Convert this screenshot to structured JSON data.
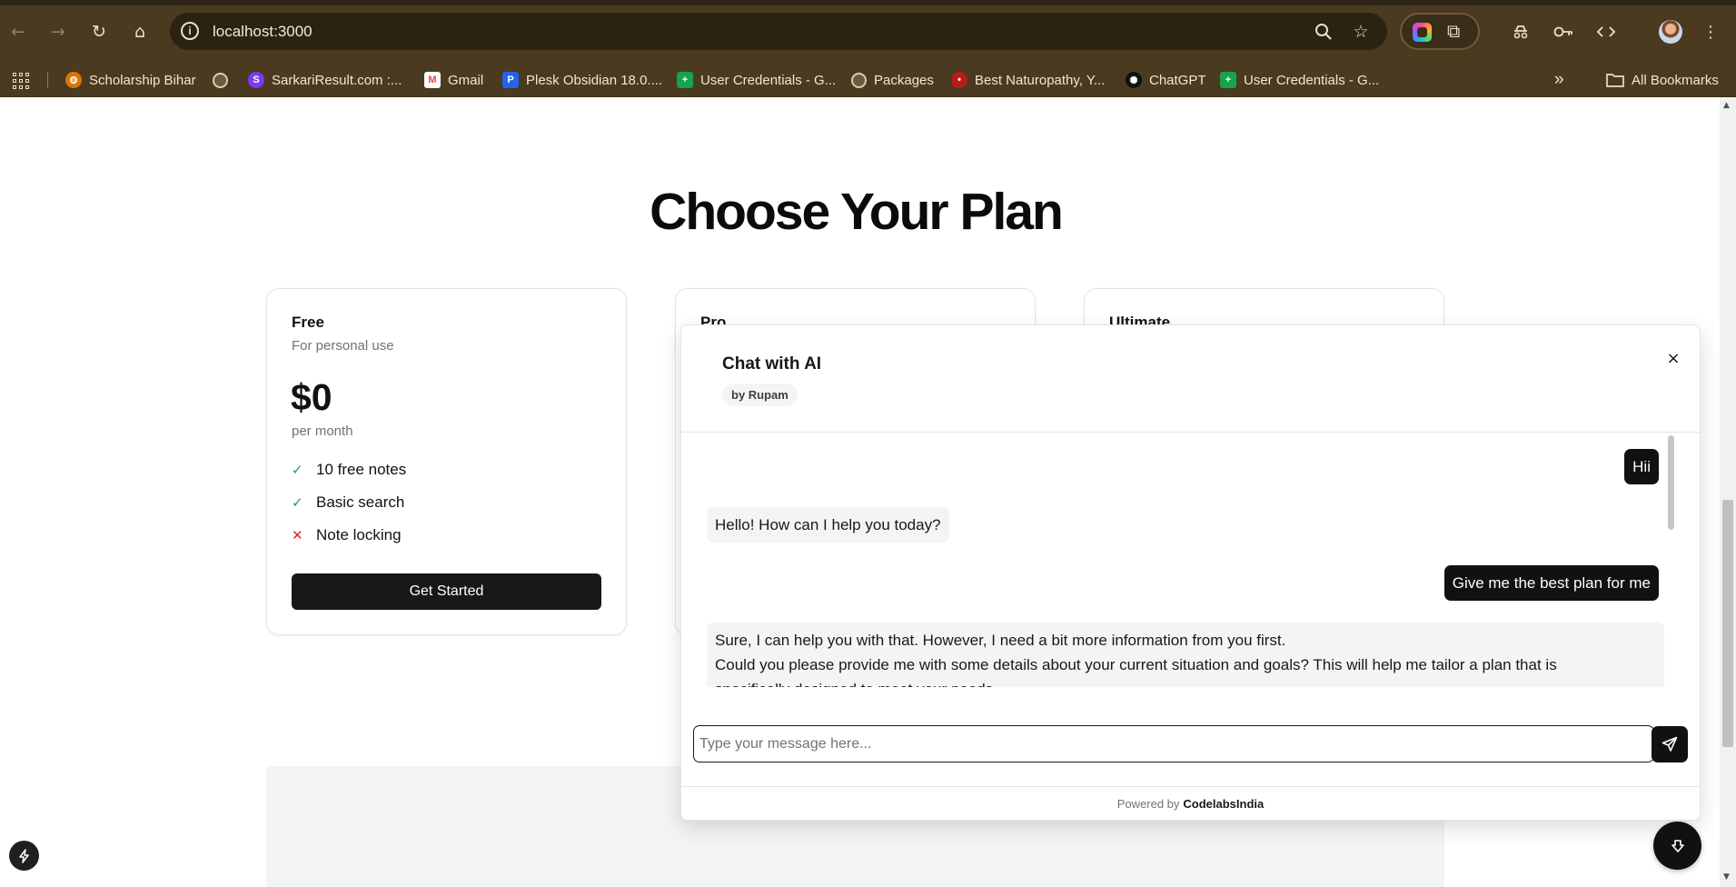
{
  "browser": {
    "url": "localhost:3000",
    "nav": {
      "back": "←",
      "forward": "→",
      "reload": "↻",
      "home": "⌂"
    },
    "icons": {
      "zoom": "zoom-icon",
      "bookmark_star": "star-icon",
      "menu": "⋮"
    },
    "bookmarks": [
      {
        "label": "Scholarship Bihar",
        "icon": "scholarship-icon",
        "color": "#d97706"
      },
      {
        "label": "",
        "icon": "globe-icon"
      },
      {
        "label": "SarkariResult.com :...",
        "icon": "sarkari-icon",
        "color": "#7c3aed"
      },
      {
        "label": "Gmail",
        "icon": "gmail-icon",
        "color": "#ea4335"
      },
      {
        "label": "Plesk Obsidian 18.0....",
        "icon": "plesk-icon",
        "color": "#2563eb"
      },
      {
        "label": "User Credentials - G...",
        "icon": "sheets-icon",
        "color": "#16a34a"
      },
      {
        "label": "Packages",
        "icon": "globe-icon"
      },
      {
        "label": "Best Naturopathy, Y...",
        "icon": "naturopathy-icon",
        "color": "#b91c1c"
      },
      {
        "label": "ChatGPT",
        "icon": "chatgpt-icon",
        "color": "#111111"
      },
      {
        "label": "User Credentials - G...",
        "icon": "sheets-icon",
        "color": "#16a34a"
      }
    ],
    "bookmarks_more": "»",
    "all_bookmarks": "All Bookmarks"
  },
  "pricing": {
    "title": "Choose Your Plan",
    "plans": [
      {
        "name": "Free",
        "description": "For personal use",
        "price": "$0",
        "period": "per month",
        "features": [
          {
            "text": "10 free notes",
            "included": true
          },
          {
            "text": "Basic search",
            "included": true
          },
          {
            "text": "Note locking",
            "included": false
          }
        ],
        "cta": "Get Started"
      },
      {
        "name": "Pro"
      },
      {
        "name": "Ultimate"
      }
    ],
    "feature_marks": {
      "yes": "✓",
      "no": "✕"
    }
  },
  "chat": {
    "title": "Chat with AI",
    "badge": "by Rupam",
    "close": "×",
    "messages": [
      {
        "role": "user",
        "text": "Hii"
      },
      {
        "role": "assistant",
        "text": "Hello! How can I help you today?"
      },
      {
        "role": "user",
        "text": "Give me the best plan for me"
      },
      {
        "role": "assistant",
        "lines": [
          "Sure, I can help you with that. However, I need a bit more information from you first.",
          "Could you please provide me with some details about your current situation and goals? This will help me tailor a plan that is",
          "specifically designed to meet your needs."
        ]
      }
    ],
    "input_placeholder": "Type your message here...",
    "input_value": "",
    "footer_prefix": "Powered by",
    "footer_brand": "CodelabsIndia"
  },
  "colors": {
    "chrome": "#4a3a1f",
    "primary": "#111111",
    "check": "#16a34a",
    "cross": "#dc2626"
  }
}
